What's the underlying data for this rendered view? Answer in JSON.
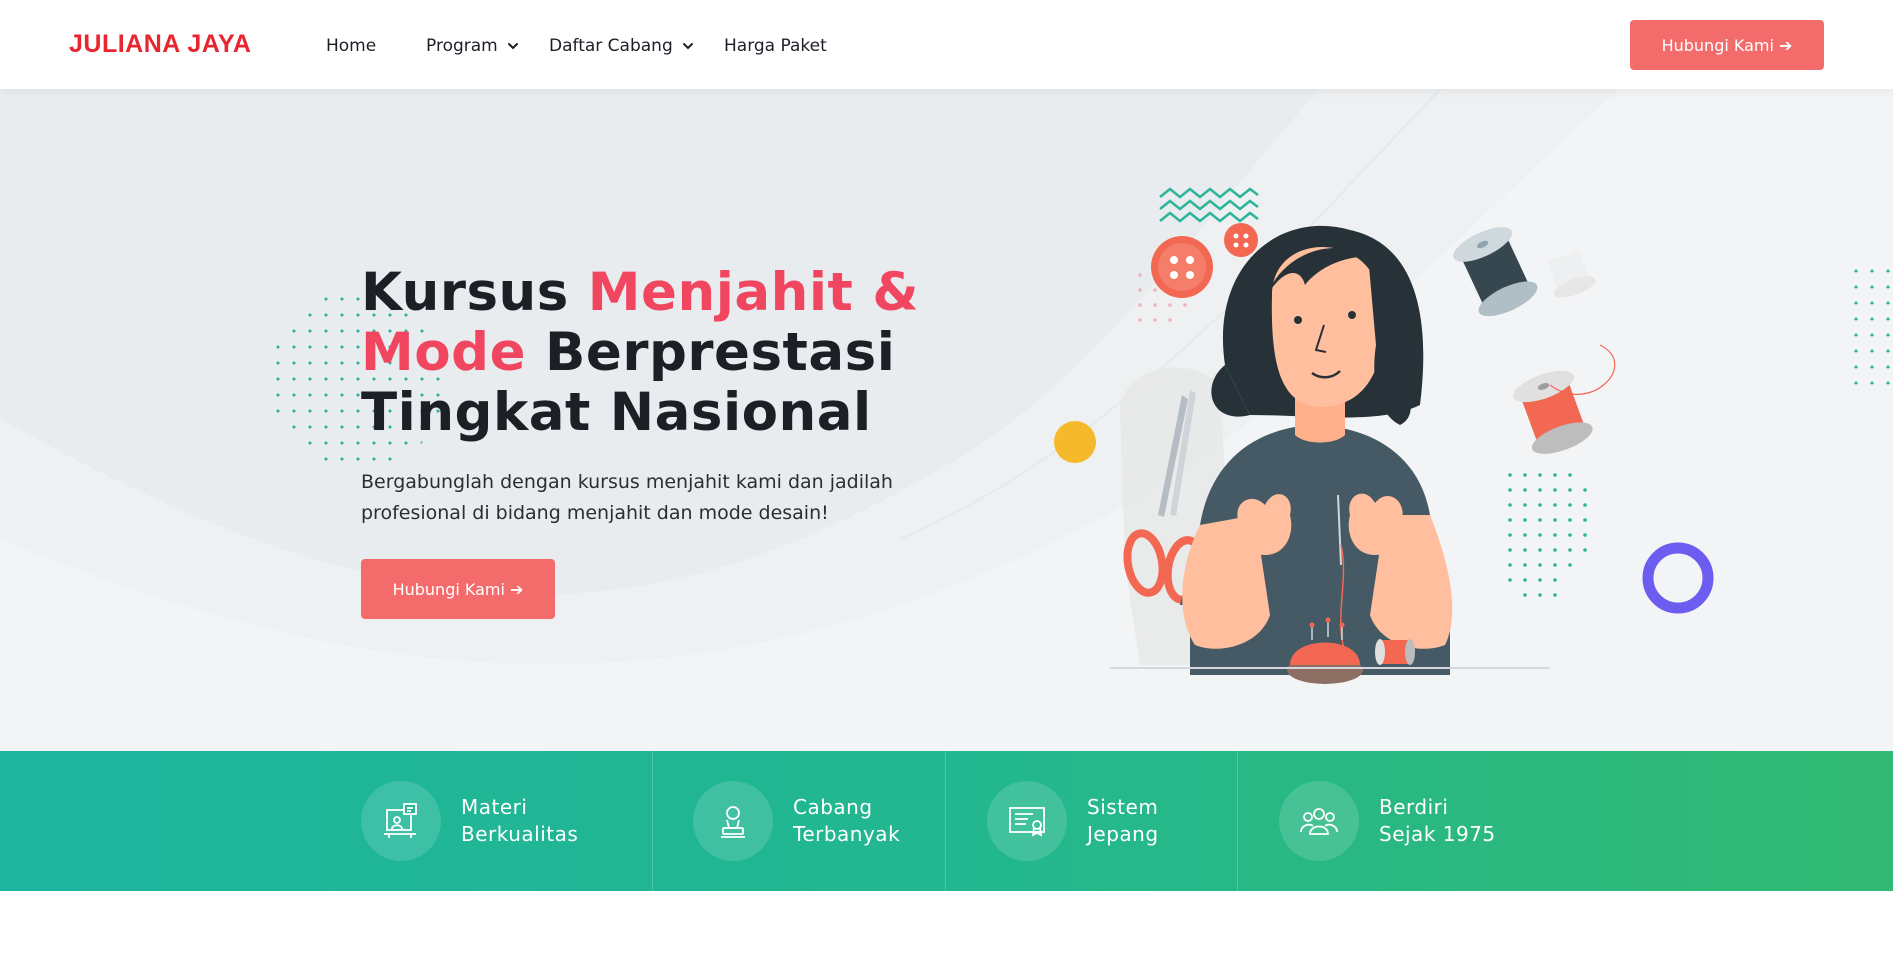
{
  "brand": {
    "name": "JULIANA JAYA",
    "color": "#e8262f"
  },
  "nav": {
    "items": [
      {
        "label": "Home",
        "dropdown": false
      },
      {
        "label": "Program",
        "dropdown": true
      },
      {
        "label": "Daftar Cabang",
        "dropdown": true
      },
      {
        "label": "Harga Paket",
        "dropdown": false
      }
    ],
    "cta_label": "Hubungi Kami ➔"
  },
  "hero": {
    "title_part1": "Kursus ",
    "title_accent": "Menjahit & Mode",
    "title_part2": " Berprestasi Tingkat Nasional",
    "description": "Bergabunglah dengan kursus menjahit kami dan jadilah profesional di bidang menjahit dan mode desain!",
    "cta_label": "Hubungi Kami ➔",
    "accent_color": "#f0465f",
    "button_color": "#f36b6b"
  },
  "features": [
    {
      "line1": "Materi",
      "line2": "Berkualitas",
      "icon": "presentation-icon"
    },
    {
      "line1": "Cabang",
      "line2": "Terbanyak",
      "icon": "person-stamp-icon"
    },
    {
      "line1": "Sistem",
      "line2": "Jepang",
      "icon": "certificate-icon"
    },
    {
      "line1": "Berdiri",
      "line2": "Sejak 1975",
      "icon": "group-icon"
    }
  ],
  "colors": {
    "features_gradient_start": "#1db59e",
    "features_gradient_end": "#32ba74",
    "hero_bg": "#f2f4f6"
  }
}
